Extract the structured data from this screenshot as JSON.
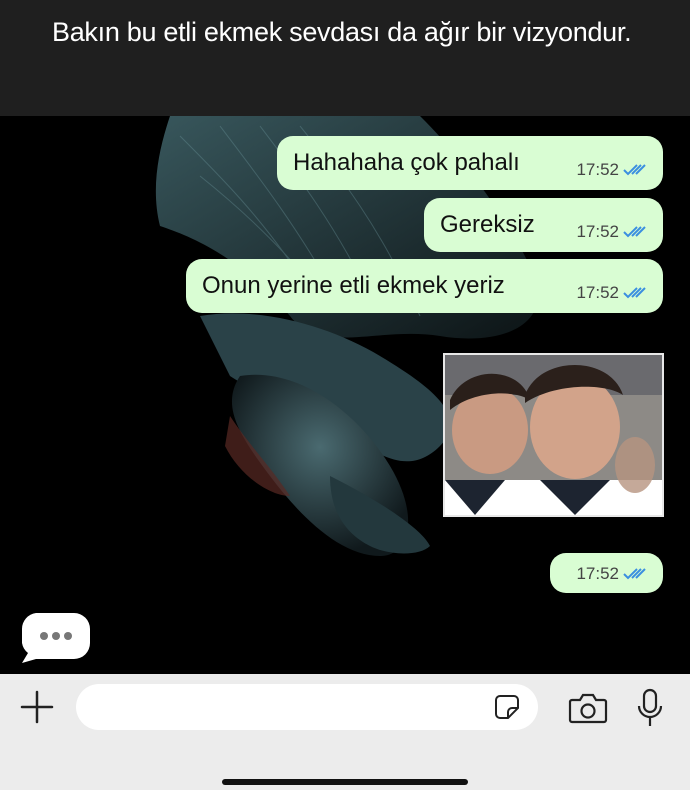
{
  "story": {
    "caption": "Bakın bu etli ekmek sevdası da ağır bir vizyondur."
  },
  "messages": [
    {
      "type": "text",
      "text": "Hahahaha çok pahalı",
      "time": "17:52",
      "status": "read"
    },
    {
      "type": "text",
      "text": "Gereksiz",
      "time": "17:52",
      "status": "read"
    },
    {
      "type": "text",
      "text": "Onun yerine etli ekmek yeriz",
      "time": "17:52",
      "status": "read"
    },
    {
      "type": "image",
      "description_icon": "photo-thumbnail",
      "time": "17:52",
      "status": "read"
    }
  ],
  "colors": {
    "outgoing_bubble": "#d9fdd3",
    "read_ticks": "#3b8fe0",
    "input_bar": "#ececec",
    "chat_background": "#000000"
  },
  "icons": {
    "attach": "plus-icon",
    "sticker": "sticker-icon",
    "camera": "camera-icon",
    "mic": "microphone-icon",
    "typing": "typing-indicator-icon"
  }
}
